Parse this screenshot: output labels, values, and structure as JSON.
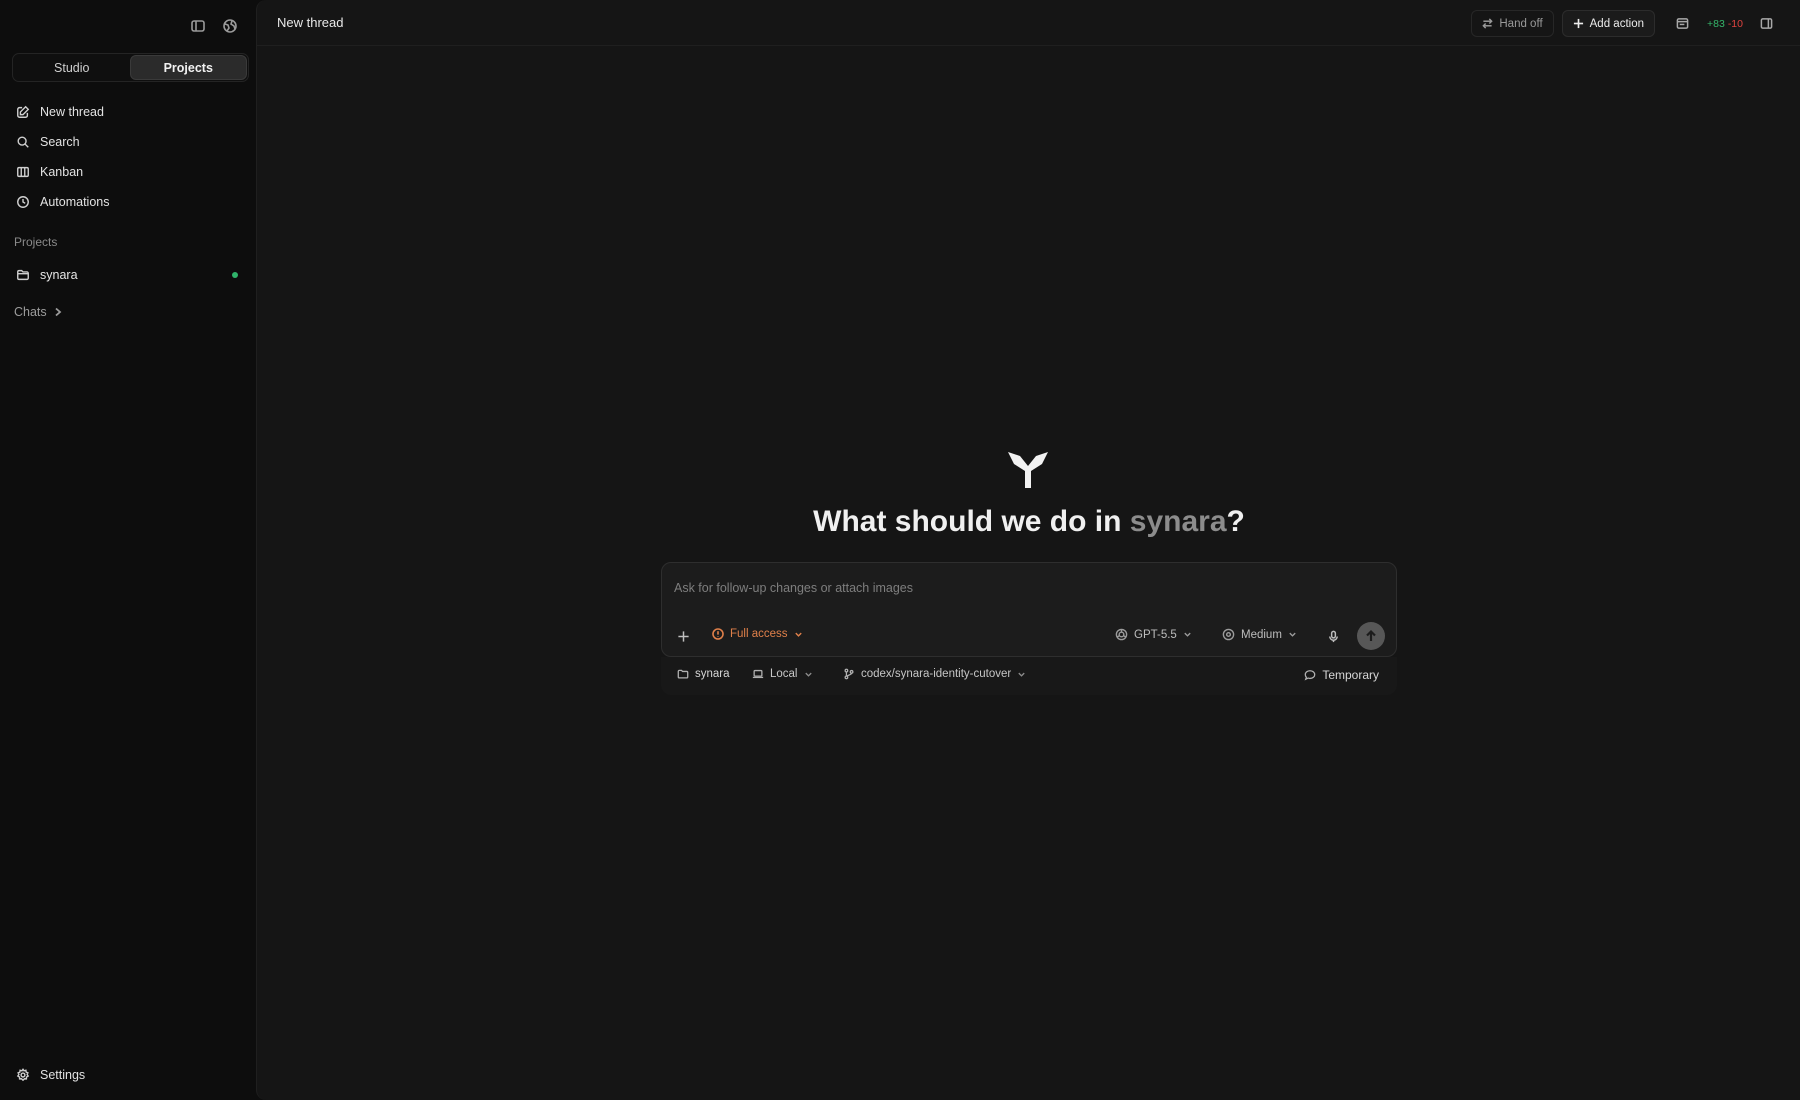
{
  "sidebar": {
    "tabs": [
      {
        "label": "Studio",
        "active": false
      },
      {
        "label": "Projects",
        "active": true
      }
    ],
    "nav": [
      {
        "label": "New thread",
        "icon": "edit-icon"
      },
      {
        "label": "Search",
        "icon": "search-icon"
      },
      {
        "label": "Kanban",
        "icon": "kanban-icon"
      },
      {
        "label": "Automations",
        "icon": "clock-icon"
      }
    ],
    "projects_label": "Projects",
    "project": {
      "name": "synara",
      "status_color": "#2fb36a"
    },
    "chats_label": "Chats",
    "settings_label": "Settings"
  },
  "topbar": {
    "title": "New thread",
    "hand_off_label": "Hand off",
    "add_action_label": "Add action",
    "diff_added": "+83",
    "diff_removed": "-10"
  },
  "hero": {
    "prefix": "What should we do in ",
    "project": "synara",
    "suffix": "?"
  },
  "composer": {
    "placeholder": "Ask for follow-up changes or attach images",
    "value": "",
    "access_label": "Full access",
    "model_label": "GPT-5.5",
    "effort_label": "Medium"
  },
  "context": {
    "project": "synara",
    "environment": "Local",
    "branch": "codex/synara-identity-cutover",
    "mode": "Temporary"
  },
  "colors": {
    "background": "#0d0d0d",
    "panel": "#151515",
    "accent_warning": "#e0804a",
    "diff_add": "#35b56a",
    "diff_remove": "#e0433f"
  }
}
